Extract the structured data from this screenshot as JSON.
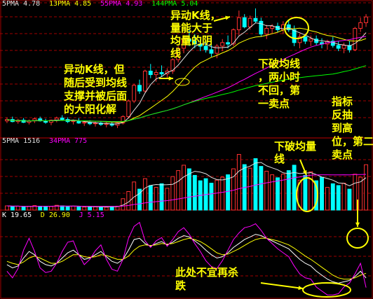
{
  "chart_data": [
    {
      "type": "candlestick",
      "panel": "price",
      "legend": [
        {
          "name": "5PMA",
          "value": "4.78",
          "color": "#e0e0e0"
        },
        {
          "name": "13PMA",
          "value": "4.85",
          "color": "#ffff00"
        },
        {
          "name": "55PMA",
          "value": "4.93",
          "color": "#ff00ff"
        },
        {
          "name": "144PMA",
          "value": "5.04",
          "color": "#00ff00"
        }
      ],
      "ylim": [
        3.8,
        5.6
      ],
      "candles": [
        [
          4.0,
          4.05,
          3.97,
          4.02
        ],
        [
          4.02,
          4.06,
          3.98,
          3.99
        ],
        [
          3.99,
          4.03,
          3.96,
          4.01
        ],
        [
          4.01,
          4.04,
          3.97,
          3.98
        ],
        [
          3.98,
          4.02,
          3.95,
          4.0
        ],
        [
          4.0,
          4.05,
          3.97,
          4.03
        ],
        [
          4.03,
          4.06,
          3.99,
          4.0
        ],
        [
          4.0,
          4.03,
          3.96,
          3.98
        ],
        [
          3.98,
          4.02,
          3.94,
          4.01
        ],
        [
          4.01,
          4.06,
          3.98,
          4.04
        ],
        [
          4.04,
          4.08,
          4.0,
          4.02
        ],
        [
          4.02,
          4.05,
          3.97,
          3.99
        ],
        [
          3.99,
          4.02,
          3.95,
          4.0
        ],
        [
          4.0,
          4.04,
          3.96,
          3.97
        ],
        [
          3.97,
          4.0,
          3.93,
          3.98
        ],
        [
          3.98,
          4.01,
          3.94,
          3.96
        ],
        [
          3.96,
          3.99,
          3.92,
          3.97
        ],
        [
          3.97,
          4.0,
          3.93,
          3.95
        ],
        [
          3.95,
          3.98,
          3.91,
          3.96
        ],
        [
          3.96,
          3.99,
          3.92,
          3.94
        ],
        [
          3.94,
          3.98,
          3.9,
          3.97
        ],
        [
          3.97,
          4.08,
          3.95,
          4.06
        ],
        [
          4.06,
          4.3,
          4.04,
          4.28
        ],
        [
          4.28,
          4.52,
          4.25,
          4.5
        ],
        [
          4.5,
          4.58,
          4.38,
          4.42
        ],
        [
          4.42,
          4.72,
          4.4,
          4.7
        ],
        [
          4.7,
          4.8,
          4.6,
          4.65
        ],
        [
          4.65,
          4.72,
          4.55,
          4.68
        ],
        [
          4.68,
          4.78,
          4.62,
          4.66
        ],
        [
          4.66,
          4.74,
          4.6,
          4.7
        ],
        [
          4.7,
          4.88,
          4.66,
          4.86
        ],
        [
          4.86,
          5.05,
          4.82,
          5.02
        ],
        [
          5.02,
          5.2,
          4.95,
          5.15
        ],
        [
          5.15,
          5.3,
          5.05,
          5.12
        ],
        [
          5.12,
          5.22,
          5.02,
          5.08
        ],
        [
          5.08,
          5.15,
          4.98,
          5.05
        ],
        [
          5.05,
          5.12,
          4.96,
          5.0
        ],
        [
          5.0,
          5.1,
          4.9,
          4.95
        ],
        [
          4.95,
          5.08,
          4.88,
          5.05
        ],
        [
          5.05,
          5.15,
          4.98,
          5.1
        ],
        [
          5.1,
          5.2,
          5.02,
          5.08
        ],
        [
          5.08,
          5.3,
          5.05,
          5.28
        ],
        [
          5.28,
          5.55,
          5.2,
          5.45
        ],
        [
          5.45,
          5.5,
          5.3,
          5.32
        ],
        [
          5.32,
          5.48,
          5.28,
          5.44
        ],
        [
          5.44,
          5.58,
          5.38,
          5.4
        ],
        [
          5.4,
          5.45,
          5.18,
          5.22
        ],
        [
          5.22,
          5.35,
          5.15,
          5.3
        ],
        [
          5.3,
          5.36,
          5.22,
          5.33
        ],
        [
          5.33,
          5.38,
          5.24,
          5.28
        ],
        [
          5.28,
          5.4,
          5.22,
          5.35
        ],
        [
          5.35,
          5.42,
          5.25,
          5.28
        ],
        [
          5.28,
          5.34,
          5.05,
          5.1
        ],
        [
          5.1,
          5.22,
          5.02,
          5.18
        ],
        [
          5.18,
          5.22,
          5.08,
          5.12
        ],
        [
          5.12,
          5.2,
          5.05,
          5.15
        ],
        [
          5.15,
          5.2,
          5.06,
          5.1
        ],
        [
          5.1,
          5.16,
          5.02,
          5.08
        ],
        [
          5.08,
          5.14,
          5.0,
          5.12
        ],
        [
          5.12,
          5.18,
          5.03,
          5.06
        ],
        [
          5.06,
          5.12,
          4.98,
          5.02
        ],
        [
          5.02,
          5.1,
          4.95,
          5.06
        ],
        [
          5.06,
          5.12,
          4.96,
          5.0
        ],
        [
          5.0,
          5.32,
          4.98,
          5.3
        ],
        [
          5.3,
          5.45,
          5.25,
          5.38
        ],
        [
          5.38,
          5.5,
          5.32,
          5.46
        ]
      ]
    },
    {
      "type": "bar",
      "panel": "volume",
      "legend": [
        {
          "name": "5PMA",
          "value": "1516",
          "color": "#e0e0e0"
        },
        {
          "name": "34PMA",
          "value": "775",
          "color": "#ff00ff"
        }
      ],
      "ylim": [
        0,
        2200
      ],
      "values": [
        140,
        120,
        130,
        110,
        125,
        150,
        130,
        115,
        120,
        160,
        140,
        120,
        130,
        110,
        100,
        115,
        105,
        110,
        95,
        120,
        130,
        380,
        620,
        940,
        700,
        1050,
        820,
        760,
        880,
        730,
        1120,
        1320,
        1500,
        1380,
        1160,
        980,
        1050,
        900,
        1000,
        1100,
        1180,
        1380,
        1860,
        1520,
        1400,
        1720,
        1460,
        1300,
        1180,
        1080,
        1200,
        1320,
        1500,
        1000,
        1160,
        1280,
        980,
        1100,
        760,
        880,
        820,
        900,
        700,
        1200,
        1100,
        1516
      ]
    },
    {
      "type": "line",
      "panel": "kdj",
      "legend": [
        {
          "name": "K",
          "value": "19.65",
          "color": "#ffffff"
        },
        {
          "name": "D",
          "value": "26.90",
          "color": "#ffff00"
        },
        {
          "name": "J",
          "value": "5.15",
          "color": "#ff00ff"
        }
      ],
      "ylim": [
        -10,
        110
      ],
      "series": [
        {
          "name": "K",
          "values": [
            40,
            35,
            38,
            50,
            60,
            55,
            45,
            40,
            38,
            42,
            50,
            58,
            62,
            55,
            48,
            50,
            55,
            60,
            52,
            45,
            42,
            48,
            62,
            78,
            80,
            72,
            68,
            72,
            75,
            70,
            74,
            80,
            84,
            82,
            76,
            70,
            62,
            55,
            50,
            52,
            58,
            66,
            72,
            78,
            82,
            86,
            84,
            80,
            76,
            72,
            68,
            64,
            56,
            48,
            42,
            38,
            30,
            24,
            18,
            14,
            12,
            14,
            16,
            22,
            30,
            19.65
          ]
        },
        {
          "name": "D",
          "values": [
            45,
            42,
            40,
            44,
            50,
            53,
            50,
            46,
            42,
            42,
            45,
            50,
            55,
            55,
            52,
            51,
            52,
            55,
            54,
            51,
            48,
            48,
            53,
            62,
            68,
            70,
            69,
            70,
            72,
            71,
            72,
            75,
            78,
            80,
            78,
            75,
            70,
            64,
            58,
            55,
            56,
            60,
            64,
            69,
            74,
            78,
            80,
            80,
            78,
            76,
            73,
            70,
            65,
            59,
            53,
            48,
            42,
            36,
            30,
            24,
            20,
            18,
            18,
            20,
            24,
            26.9
          ]
        },
        {
          "name": "J",
          "values": [
            30,
            20,
            34,
            62,
            80,
            60,
            35,
            28,
            30,
            42,
            60,
            74,
            76,
            55,
            40,
            48,
            61,
            70,
            48,
            33,
            30,
            48,
            80,
            98,
            104,
            76,
            66,
            76,
            81,
            68,
            78,
            90,
            96,
            86,
            72,
            60,
            46,
            37,
            34,
            46,
            62,
            78,
            88,
            96,
            98,
            102,
            92,
            80,
            72,
            64,
            58,
            52,
            38,
            26,
            20,
            18,
            6,
            0,
            -6,
            -6,
            -4,
            6,
            12,
            26,
            42,
            5.15
          ]
        }
      ]
    }
  ],
  "annotations": [
    {
      "id": "note-1",
      "lines": [
        "异动K线，",
        "量能大于",
        "均量的阴",
        "线"
      ]
    },
    {
      "id": "note-2",
      "lines": [
        "异动K线，但",
        "随后受到均线",
        "支撑并被后面",
        "的大阳化解"
      ]
    },
    {
      "id": "note-3",
      "lines": [
        "下破均线",
        "，两小时",
        "不回，第",
        "一卖点"
      ]
    },
    {
      "id": "note-4",
      "lines": [
        "指标",
        "反抽",
        "到高",
        "位，第二",
        "卖点"
      ]
    },
    {
      "id": "note-5",
      "lines": [
        "下破均量",
        "线"
      ]
    },
    {
      "id": "note-6",
      "lines": [
        "此处不宜再杀",
        "跌"
      ]
    }
  ],
  "colors": {
    "up": "#ff3030",
    "down": "#00ffff",
    "grid": "#a00000",
    "annotation": "#ffff00"
  }
}
